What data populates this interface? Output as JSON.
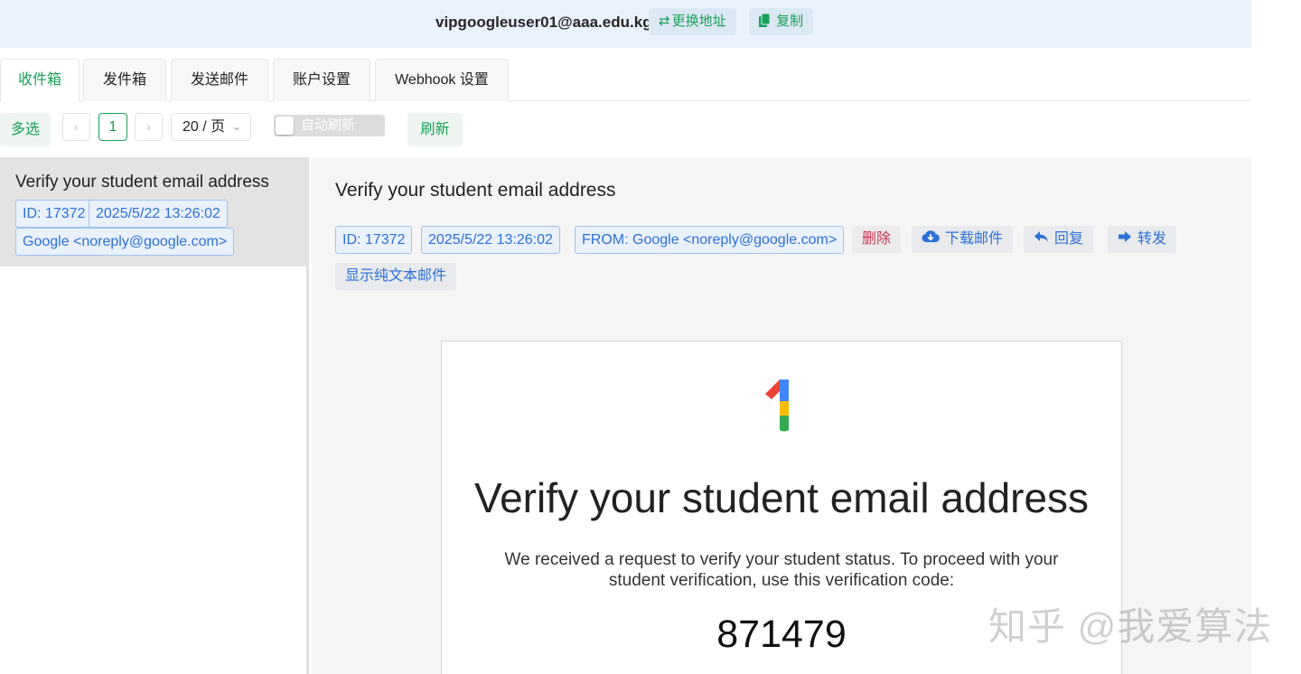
{
  "header": {
    "email": "vipgoogleuser01@aaa.edu.kg",
    "change_address_label": "更换地址",
    "copy_label": "复制"
  },
  "tabs": [
    {
      "label": "收件箱",
      "active": true
    },
    {
      "label": "发件箱",
      "active": false
    },
    {
      "label": "发送邮件",
      "active": false
    },
    {
      "label": "账户设置",
      "active": false
    },
    {
      "label": "Webhook 设置",
      "active": false
    }
  ],
  "toolbar": {
    "multi_select_label": "多选",
    "prev_icon": "chevron-left-icon",
    "current_page": "1",
    "next_icon": "chevron-right-icon",
    "page_size": "20 / 页",
    "auto_refresh_label": "自动刷新",
    "auto_refresh_on": false,
    "refresh_label": "刷新"
  },
  "mail_list": [
    {
      "subject": "Verify your student email address",
      "id": "ID: 17372",
      "time": "2025/5/22 13:26:02",
      "from": "Google <noreply@google.com>",
      "selected": true
    }
  ],
  "detail": {
    "subject": "Verify your student email address",
    "id": "ID: 17372",
    "time": "2025/5/22 13:26:02",
    "from": "FROM: Google <noreply@google.com>",
    "delete_label": "删除",
    "download_label": "下载邮件",
    "reply_label": "回复",
    "forward_label": "转发",
    "plain_text_label": "显示纯文本邮件"
  },
  "email_body": {
    "heading": "Verify your student email address",
    "text": "We received a request to verify your student status. To proceed with your student verification, use this verification code:",
    "code": "871479"
  },
  "watermark": "知乎 @我爱算法",
  "colors": {
    "accent_green": "#18a058",
    "tag_blue": "#2e6fd8",
    "danger_red": "#d03050",
    "header_bg": "#eaf2fd"
  }
}
